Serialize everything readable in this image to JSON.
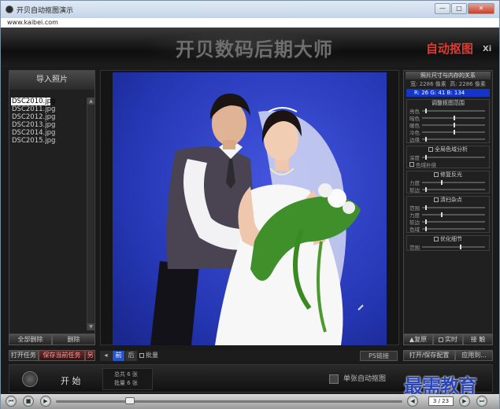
{
  "window": {
    "title": "开贝自动抠图演示",
    "url": "www.kaibei.com",
    "controls": [
      "—",
      "□",
      "✕"
    ]
  },
  "banner": {
    "title": "开贝数码后期大师",
    "badge": "自动抠图",
    "version": "Xi"
  },
  "left_panel": {
    "header": "导入照片",
    "files": [
      "DSC2010.jpg",
      "DSC2011.jpg",
      "DSC2012.jpg",
      "DSC2013.jpg",
      "DSC2014.jpg",
      "DSC2015.jpg"
    ],
    "selected_index": 0,
    "clear_all": "全部删除",
    "delete": "删除",
    "open_task": "打开任务",
    "save_task": "保存当前任务",
    "save_extra": "另"
  },
  "center_toolbar": {
    "front": "前",
    "back": "后",
    "batch": "批量",
    "ps_link": "PS链接"
  },
  "right_panel": {
    "header": "照片尺寸与内存的关系",
    "width": "宽: 2286 像素",
    "height": "高: 2286 像素",
    "rgb": "R: 26   G: 41   B: 134",
    "group1": {
      "title": "调整抠图范围",
      "sliders": [
        {
          "label": "亮色",
          "value": 0.05
        },
        {
          "label": "暗色",
          "value": 0.5
        },
        {
          "label": "暖色",
          "value": 0.5
        },
        {
          "label": "冷色",
          "value": 0.5
        },
        {
          "label": "边缘",
          "value": 0.05
        }
      ]
    },
    "group2": {
      "title": "全局色域分析",
      "sliders": [
        {
          "label": "深度",
          "value": 0.05
        }
      ],
      "checkbox": "色域补偿"
    },
    "group3": {
      "title": "修复反光",
      "sliders": [
        {
          "label": "力度",
          "value": 0.3
        },
        {
          "label": "软边",
          "value": 0.05
        }
      ]
    },
    "group4": {
      "title": "清扫杂点",
      "sliders": [
        {
          "label": "范围",
          "value": 0.05
        },
        {
          "label": "力度",
          "value": 0.3
        },
        {
          "label": "软边",
          "value": 0.05
        },
        {
          "label": "色域",
          "value": 0.05
        }
      ]
    },
    "group5": {
      "title": "优化细节",
      "sliders": [
        {
          "label": "范围",
          "value": 0.6
        }
      ]
    },
    "btn_restore": "▲复原",
    "btn_realtime": "实时",
    "btn_compare": "接 触",
    "btn_open_save": "打开/保存配置",
    "btn_apply": "应用到..."
  },
  "bottom": {
    "start": "开 始",
    "total_label": "总共 6 张",
    "batch_label": "批量 6 张",
    "single_auto": "单张自动抠图"
  },
  "watermark": "最需教育",
  "player": {
    "page": "3 / 23"
  },
  "colors": {
    "photo_background": "#2335b0",
    "rgb_panel": "#1436c8",
    "badge": "#e23a2e"
  }
}
